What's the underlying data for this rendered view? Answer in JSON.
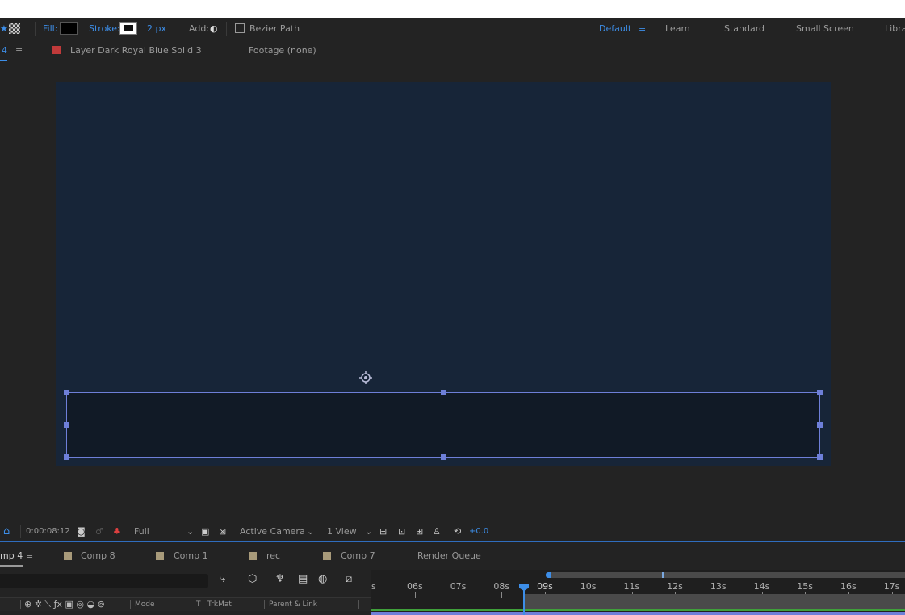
{
  "toolbar": {
    "fill_label": "Fill:",
    "stroke_label": "Stroke:",
    "stroke_width": "2 px",
    "add_label": "Add:",
    "bezier_label": "Bezier Path",
    "workspaces": [
      "Default",
      "Learn",
      "Standard",
      "Small Screen",
      "Libra"
    ],
    "active_workspace": "Default"
  },
  "panel": {
    "comp_tab_fragment": "4",
    "layer_label": "Layer",
    "layer_name": "Dark Royal Blue Solid 3",
    "footage_label": "Footage",
    "footage_value": "(none)",
    "layer_color": "#c03a3a"
  },
  "viewer_footer": {
    "timecode": "0:00:08:12",
    "resolution": "Full",
    "camera": "Active Camera",
    "views": "1 View",
    "exposure": "+0.0"
  },
  "timeline_tabs": [
    {
      "label": "mp 4",
      "color": ""
    },
    {
      "label": "Comp 8",
      "color": "#a89a7a"
    },
    {
      "label": "Comp 1",
      "color": "#a89a7a"
    },
    {
      "label": "rec",
      "color": "#a89a7a"
    },
    {
      "label": "Comp 7",
      "color": "#a89a7a"
    },
    {
      "label": "Render Queue",
      "color": ""
    }
  ],
  "column_headers": {
    "mode": "Mode",
    "t": "T",
    "trkmat": "TrkMat",
    "parent": "Parent & Link"
  },
  "ruler": {
    "ticks": [
      "s",
      "06s",
      "07s",
      "08s",
      "09s",
      "10s",
      "11s",
      "12s",
      "13s",
      "14s",
      "15s",
      "16s",
      "17s"
    ]
  },
  "colors": {
    "accent": "#3d8ee8",
    "comp_background": "#172538",
    "shape_fill": "#111a26",
    "selection": "#6e7fd8"
  }
}
